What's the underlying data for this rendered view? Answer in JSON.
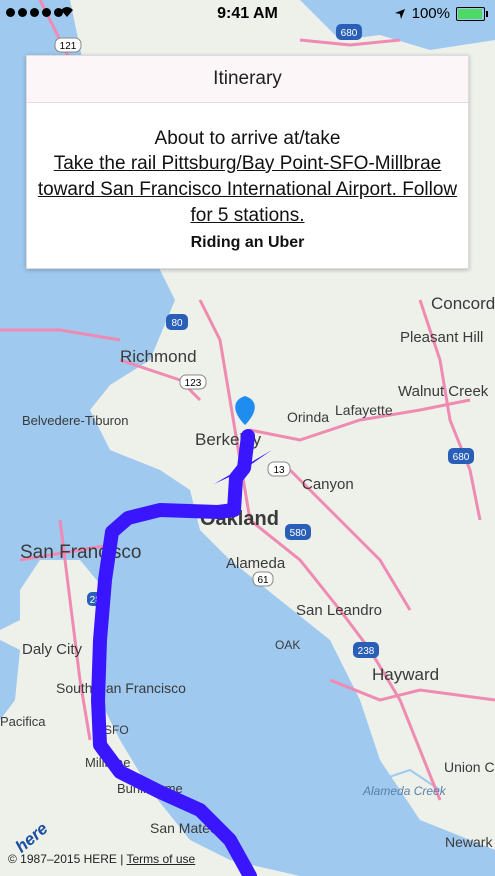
{
  "status_bar": {
    "time": "9:41 AM",
    "battery_percent": "100%",
    "battery_level": 1.0
  },
  "itinerary": {
    "title": "Itinerary",
    "about_text": "About to arrive at/take",
    "instruction": "Take the rail Pittsburg/Bay Point-SFO-Millbrae toward San Francisco International Airport. Follow for 5 stations.",
    "mode": "Riding an Uber"
  },
  "map": {
    "route_color": "#3a16ff",
    "water_color": "#9fc9ef",
    "land_color": "#eef0ea",
    "marker_color": "#1f8cf0",
    "labels": {
      "richmond": "Richmond",
      "concord": "Concord",
      "pleasant_hill": "Pleasant Hill",
      "walnut_creek": "Walnut Creek",
      "lafayette": "Lafayette",
      "orinda": "Orinda",
      "berkeley": "Berkeley",
      "canyon": "Canyon",
      "oakland": "Oakland",
      "alameda": "Alameda",
      "san_francisco": "San Francisco",
      "san_leandro": "San Leandro",
      "oak": "OAK",
      "daly_city": "Daly City",
      "south_sf": "South San Francisco",
      "sfo": "SFO",
      "millbrae": "Millbrae",
      "burlingame": "Burlingame",
      "san_mateo": "San Mateo",
      "hayward": "Hayward",
      "union_city": "Union City",
      "newark": "Newark",
      "belvedere": "Belvedere-Tiburon",
      "pacifica": "Pacifica",
      "alameda_creek": "Alameda Creek"
    },
    "shields": {
      "s121": "121",
      "s680": "680",
      "s80": "80",
      "s123": "123",
      "s13": "13",
      "s580": "580",
      "s61": "61",
      "s238": "238",
      "s680b": "680",
      "s280": "280"
    }
  },
  "attribution": {
    "copyright": "© 1987–2015 HERE |",
    "terms": "Terms of use",
    "logo": "here"
  }
}
